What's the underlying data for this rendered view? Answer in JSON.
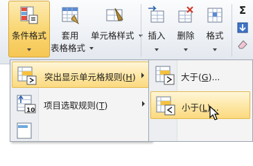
{
  "ribbon": {
    "conditional_format": {
      "label": "条件格式"
    },
    "table_format": {
      "label_line1": "套用",
      "label_line2": "表格格式"
    },
    "cell_styles": {
      "label": "单元格样式"
    },
    "insert": {
      "label": "插入"
    },
    "delete": {
      "label": "删除"
    },
    "format": {
      "label": "格式"
    },
    "sigma": "Σ"
  },
  "menu": {
    "items": [
      {
        "label": "突出显示单元格规则",
        "shortcut_prefix": "(",
        "shortcut_key": "H",
        "shortcut_suffix": ")",
        "icon": "highlight-rules-icon"
      },
      {
        "label": "项目选取规则",
        "shortcut_prefix": "(",
        "shortcut_key": "T",
        "shortcut_suffix": ")",
        "icon": "top-bottom-rules-icon",
        "icon_text": "10"
      }
    ]
  },
  "submenu": {
    "items": [
      {
        "label": "大于",
        "shortcut_prefix": "(",
        "shortcut_key": "G",
        "shortcut_suffix": ")...",
        "icon": "greater-than-icon"
      },
      {
        "label": "小于",
        "shortcut_prefix": "(",
        "shortcut_key": "L",
        "shortcut_suffix": ")...",
        "icon": "less-than-icon"
      }
    ]
  },
  "colors": {
    "highlight": "#fbd97f",
    "ribbon_bg": "#eef1f5",
    "accent_red": "#d23a2a"
  }
}
